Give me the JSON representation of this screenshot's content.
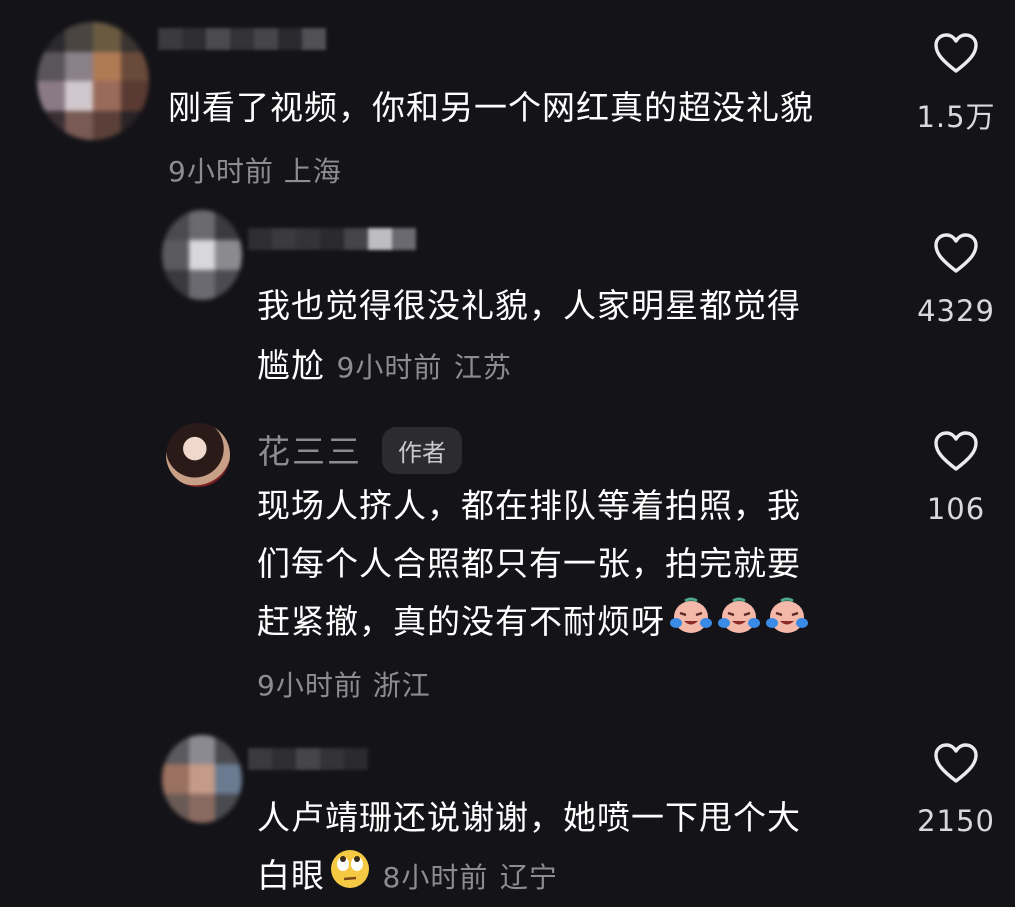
{
  "comments": [
    {
      "text": "刚看了视频，你和另一个网红真的超没礼貌",
      "time": "9小时前",
      "location": "上海",
      "likes": "1.5万"
    },
    {
      "line1": "我也觉得很没礼貌，人家明星都觉得",
      "line2": "尴尬",
      "time": "9小时前",
      "location": "江苏",
      "likes": "4329"
    },
    {
      "name": "花三三",
      "badge": "作者",
      "line1": "现场人挤人，都在排队等着拍照，我",
      "line2": "们每个人合照都只有一张，拍完就要",
      "line3": "赶紧撤，真的没有不耐烦呀",
      "emoji": "crying-laughing-face",
      "time": "9小时前",
      "location": "浙江",
      "likes": "106"
    },
    {
      "line1": "人卢靖珊还说谢谢，她喷一下甩个大",
      "line2": "白眼",
      "emoji": "eye-roll-face",
      "time": "8小时前",
      "location": "辽宁",
      "likes": "2150"
    }
  ],
  "colors": {
    "background": "#141418",
    "text": "#ffffff",
    "meta": "#8c8c91",
    "badge_bg": "#2b2b30"
  }
}
